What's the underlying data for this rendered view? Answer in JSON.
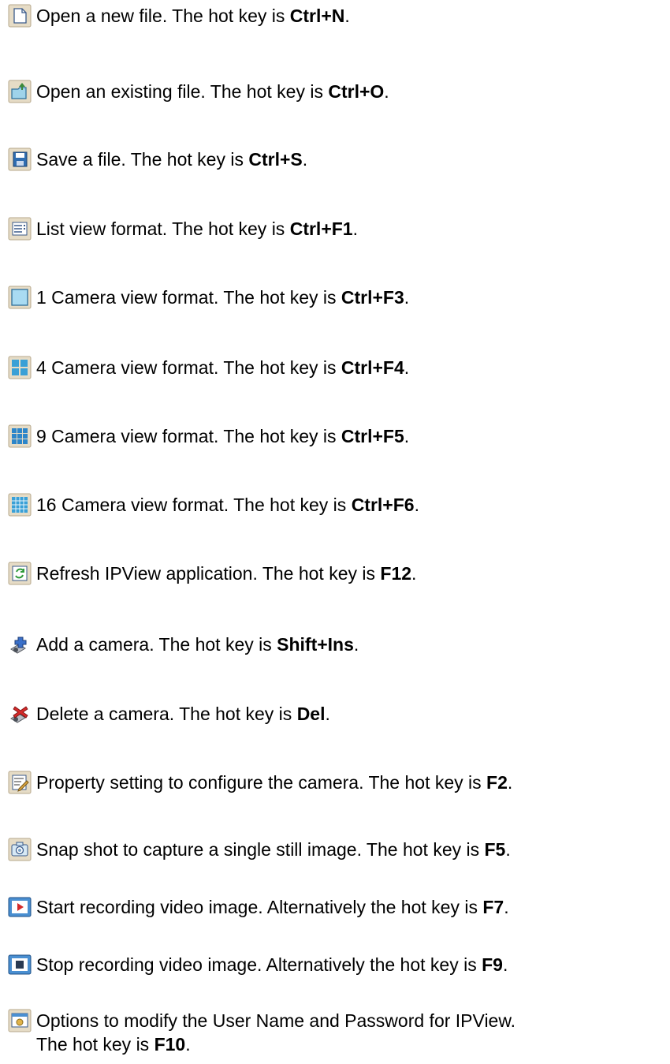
{
  "entries": [
    {
      "icon": "new-file-icon",
      "text": "Open a new file.  The hot key is ",
      "key": "Ctrl+N",
      "end": "."
    },
    {
      "icon": "open-file-icon",
      "text": "Open an existing file.  The hot key is ",
      "key": "Ctrl+O",
      "end": "."
    },
    {
      "icon": "save-disk-icon",
      "text": "Save a file. The hot key is ",
      "key": "Ctrl+S",
      "end": "."
    },
    {
      "icon": "list-view-icon",
      "text": "List view format. The hot key is ",
      "key": "Ctrl+F1",
      "end": "."
    },
    {
      "icon": "one-camera-view-icon",
      "text": "1 Camera view format.  The hot key is ",
      "key": "Ctrl+F3",
      "end": "."
    },
    {
      "icon": "four-camera-view-icon",
      "text": "4 Camera view format.  The hot key is ",
      "key": "Ctrl+F4",
      "end": "."
    },
    {
      "icon": "nine-camera-view-icon",
      "text": "9 Camera view format. The hot key is ",
      "key": "Ctrl+F5",
      "end": "."
    },
    {
      "icon": "sixteen-camera-view-icon",
      "text": "16 Camera view format.  The hot key is ",
      "key": "Ctrl+F6",
      "end": "."
    },
    {
      "icon": "refresh-icon",
      "text": "Refresh IPView application. The hot key is ",
      "key": "F12",
      "end": "."
    },
    {
      "icon": "add-camera-icon",
      "text": "Add a camera.  The hot key is ",
      "key": "Shift+Ins",
      "end": "."
    },
    {
      "icon": "delete-camera-icon",
      "text": "Delete a camera.  The hot key is ",
      "key": "Del",
      "end": "."
    },
    {
      "icon": "property-setting-icon",
      "text": "Property setting to configure the camera.  The hot key is ",
      "key": "F2",
      "end": "."
    },
    {
      "icon": "snapshot-camera-icon",
      "text": "Snap shot to capture a single still image. The hot key is ",
      "key": "F5",
      "end": "."
    },
    {
      "icon": "start-recording-icon",
      "text": "Start recording video image.  Alternatively the hot key is ",
      "key": "F7",
      "end": "."
    },
    {
      "icon": "stop-recording-icon",
      "text": "Stop recording video image.  Alternatively the hot key is ",
      "key": "F9",
      "end": "."
    },
    {
      "icon": "options-icon",
      "text": "Options to modify the User Name and Password for IPView.",
      "line2_text": "The hot key is ",
      "key": "F10",
      "end": "."
    }
  ]
}
